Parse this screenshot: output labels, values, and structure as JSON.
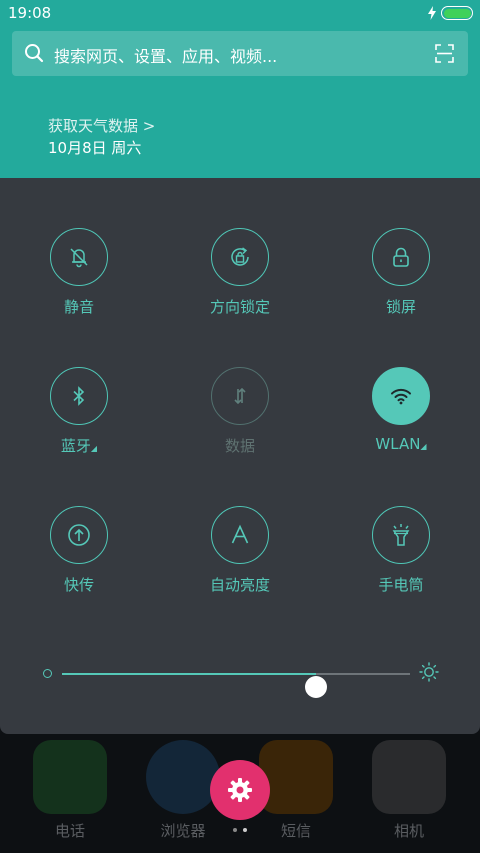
{
  "status": {
    "time": "19:08",
    "battery_level": 1.0,
    "battery_color": "#3fd15a"
  },
  "search": {
    "placeholder": "搜索网页、设置、应用、视频..."
  },
  "weather": {
    "link": "获取天气数据 >",
    "date": "10月8日 周六"
  },
  "colors": {
    "header": "#23aa9c",
    "accent": "#55c8b8",
    "panel": "#363a40",
    "fab": "#e2306e"
  },
  "tiles": [
    {
      "label": "静音",
      "icon": "bell-off-icon",
      "state": "off"
    },
    {
      "label": "方向锁定",
      "icon": "rotation-lock-icon",
      "state": "off"
    },
    {
      "label": "锁屏",
      "icon": "lock-icon",
      "state": "off"
    },
    {
      "label": "蓝牙",
      "icon": "bluetooth-icon",
      "state": "off",
      "expandable": true
    },
    {
      "label": "数据",
      "icon": "mobile-data-icon",
      "state": "disabled"
    },
    {
      "label": "WLAN",
      "icon": "wifi-icon",
      "state": "on",
      "expandable": true
    },
    {
      "label": "快传",
      "icon": "quick-transfer-icon",
      "state": "off"
    },
    {
      "label": "自动亮度",
      "icon": "auto-brightness-icon",
      "state": "off"
    },
    {
      "label": "手电筒",
      "icon": "flashlight-icon",
      "state": "off"
    }
  ],
  "brightness": {
    "level": 0.73
  },
  "dock": [
    {
      "label": "电话",
      "icon": "phone-icon",
      "color": "#1f6b33"
    },
    {
      "label": "浏览器",
      "icon": "browser-icon",
      "color": "#1e4a73"
    },
    {
      "label": "短信",
      "icon": "message-icon",
      "color": "#7a4a10"
    },
    {
      "label": "相机",
      "icon": "camera-icon",
      "color": "#55575a"
    }
  ],
  "pages": {
    "count": 2,
    "current": 2
  }
}
